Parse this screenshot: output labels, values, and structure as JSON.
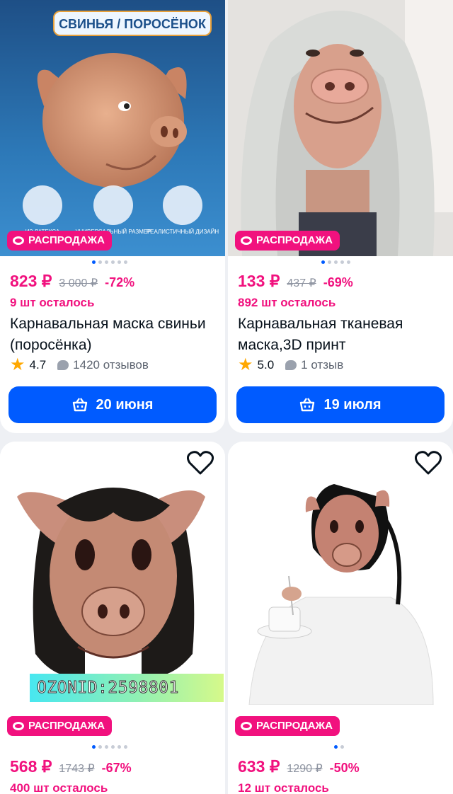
{
  "products": [
    {
      "badge": "РАСПРОДАЖА",
      "image_banner": "СВИНЬЯ / ПОРОСЁНОК",
      "image_features": [
        "ИЗ ЛАТЕКСА",
        "УНИВЕРСАЛЬНЫЙ РАЗМЕР",
        "РЕАЛИСТИЧНЫЙ ДИЗАЙН"
      ],
      "price": "823 ₽",
      "old_price": "3 000 ₽",
      "discount": "-72%",
      "stock": "9 шт осталось",
      "title": "Карнавальная маска свиньи (поросёнка)",
      "rating": "4.7",
      "reviews": "1420 отзывов",
      "cta": "20 июня",
      "slides": 6,
      "active_slide": 1
    },
    {
      "badge": "РАСПРОДАЖА",
      "price": "133 ₽",
      "old_price": "437 ₽",
      "discount": "-69%",
      "stock": "892 шт осталось",
      "title": "Карнавальная тканевая маска,3D принт",
      "rating": "5.0",
      "reviews": "1 отзыв",
      "cta": "19 июля",
      "slides": 5,
      "active_slide": 1
    },
    {
      "badge": "РАСПРОДАЖА",
      "watermark": "OZONID:2598801",
      "price": "568 ₽",
      "old_price": "1743 ₽",
      "discount": "-67%",
      "stock": "400 шт осталось",
      "slides": 6,
      "active_slide": 1
    },
    {
      "badge": "РАСПРОДАЖА",
      "price": "633 ₽",
      "old_price": "1290 ₽",
      "discount": "-50%",
      "stock": "12 шт осталось",
      "slides": 2,
      "active_slide": 1
    }
  ],
  "colors": {
    "accent": "#f1117e",
    "primary": "#005bff",
    "star": "#ffa800"
  }
}
